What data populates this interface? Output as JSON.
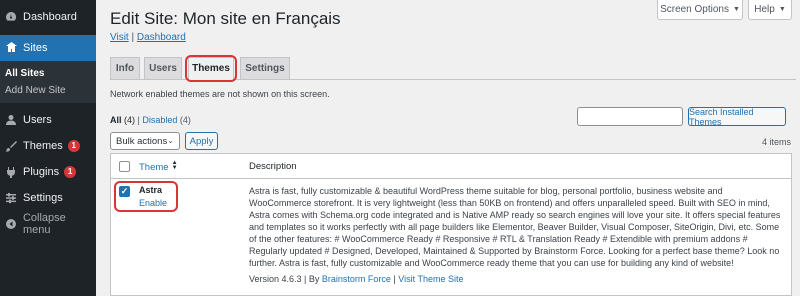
{
  "sidebar": {
    "dashboard": "Dashboard",
    "sites": "Sites",
    "sub_all_sites": "All Sites",
    "sub_add_new": "Add New Site",
    "users": "Users",
    "themes": "Themes",
    "themes_badge": "1",
    "plugins": "Plugins",
    "plugins_badge": "1",
    "settings": "Settings",
    "collapse": "Collapse menu"
  },
  "header": {
    "screen_options": "Screen Options",
    "help": "Help",
    "title": "Edit Site: Mon site en Français",
    "link_visit": "Visit",
    "link_separator": " | ",
    "link_dashboard": "Dashboard"
  },
  "tabs": {
    "info": "Info",
    "users": "Users",
    "themes": "Themes",
    "settings": "Settings"
  },
  "notice": "Network enabled themes are not shown on this screen.",
  "filters": {
    "all": "All",
    "all_count": "(4)",
    "separator": " | ",
    "disabled": "Disabled",
    "disabled_count": "(4)"
  },
  "search": {
    "placeholder": "",
    "button": "Search Installed Themes"
  },
  "bulk": {
    "label": "Bulk actions",
    "apply": "Apply",
    "items_count": "4 items"
  },
  "table": {
    "col_theme": "Theme",
    "col_description": "Description",
    "rows": [
      {
        "name": "Astra",
        "action": "Enable",
        "description": "Astra is fast, fully customizable & beautiful WordPress theme suitable for blog, personal portfolio, business website and WooCommerce storefront. It is very lightweight (less than 50KB on frontend) and offers unparalleled speed. Built with SEO in mind, Astra comes with Schema.org code integrated and is Native AMP ready so search engines will love your site. It offers special features and templates so it works perfectly with all page builders like Elementor, Beaver Builder, Visual Composer, SiteOrigin, Divi, etc. Some of the other features: # WooCommerce Ready # Responsive # RTL & Translation Ready # Extendible with premium addons # Regularly updated # Designed, Developed, Maintained & Supported by Brainstorm Force. Looking for a perfect base theme? Look no further. Astra is fast, fully customizable and WooCommerce ready theme that you can use for building any kind of website!",
        "version": "Version 4.6.3",
        "by": " | By ",
        "author": "Brainstorm Force",
        "sep": " | ",
        "visit": "Visit Theme Site"
      }
    ]
  },
  "colors": {
    "accent": "#2271b1",
    "sidebar_bg": "#1d2327",
    "highlight": "#d63638"
  }
}
